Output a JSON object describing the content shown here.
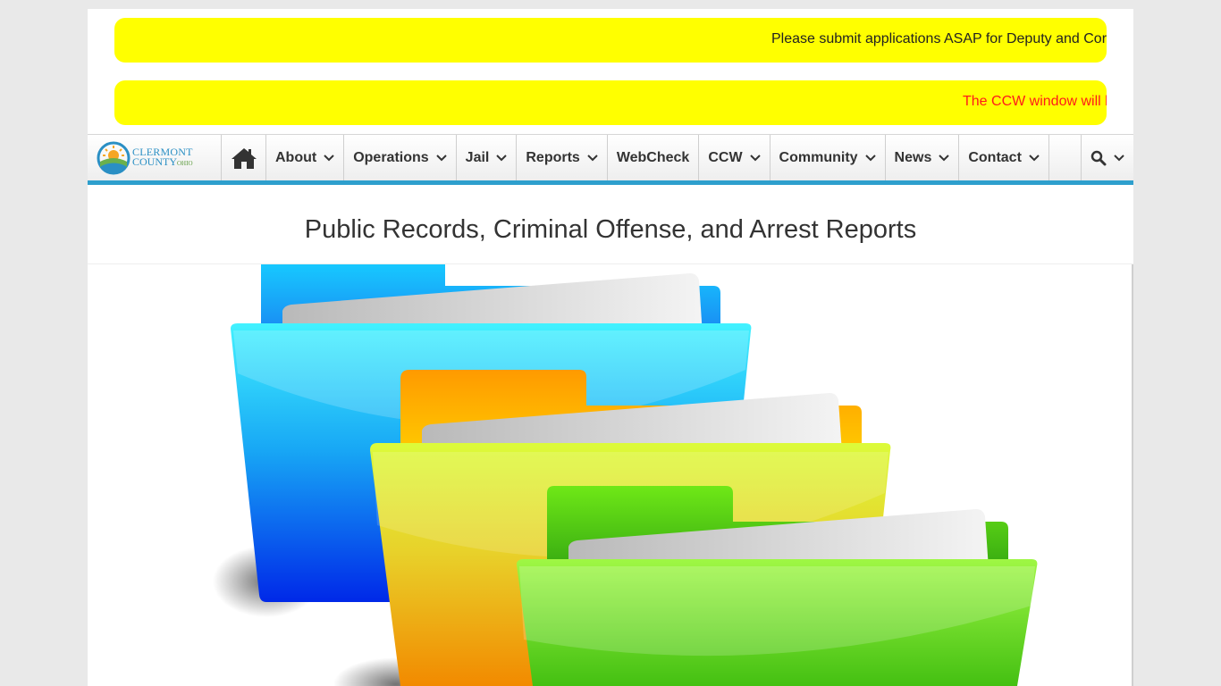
{
  "alerts": {
    "ticker_1": "Please submit applications ASAP for Deputy and Cor",
    "ticker_2": "The CCW window will l"
  },
  "brand": {
    "line1": "CLERMONT",
    "line2": "COUNTY",
    "line2_small": "OHIO"
  },
  "nav": {
    "about": "About",
    "operations": "Operations",
    "jail": "Jail",
    "reports": "Reports",
    "webcheck": "WebCheck",
    "ccw": "CCW",
    "community": "Community",
    "news": "News",
    "contact": "Contact"
  },
  "page": {
    "title": "Public Records, Criminal Offense, and Arrest Reports"
  },
  "colors": {
    "alert_bg": "#ffff00",
    "alert_text_red": "#ff1a1a",
    "nav_accent": "#2e9fcd"
  },
  "icons": {
    "home": "home-icon",
    "search": "search-icon",
    "chevron": "chevron-down-icon"
  }
}
